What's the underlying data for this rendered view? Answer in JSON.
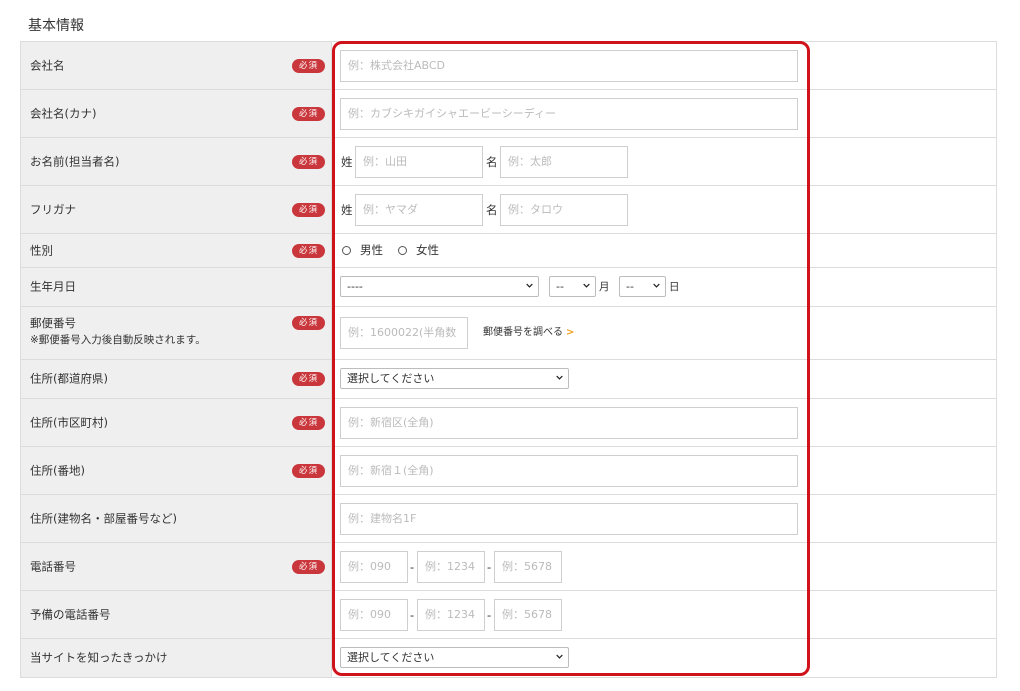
{
  "section_title": "基本情報",
  "required_label": "必須",
  "fields": {
    "company_name": {
      "label": "会社名",
      "placeholder": "例：株式会社ABCD"
    },
    "company_kana": {
      "label": "会社名(カナ)",
      "placeholder": "例：カブシキガイシャエービーシーディー"
    },
    "person_name": {
      "label": "お名前(担当者名)",
      "last_label": "姓",
      "last_placeholder": "例：山田",
      "first_label": "名",
      "first_placeholder": "例：太郎"
    },
    "furigana": {
      "label": "フリガナ",
      "last_label": "姓",
      "last_placeholder": "例：ヤマダ",
      "first_label": "名",
      "first_placeholder": "例：タロウ"
    },
    "gender": {
      "label": "性別",
      "options": [
        "男性",
        "女性"
      ]
    },
    "birthday": {
      "label": "生年月日",
      "year_value": "----",
      "month_value": "--",
      "month_unit": "月",
      "day_value": "--",
      "day_unit": "日"
    },
    "postal": {
      "label": "郵便番号",
      "note": "※郵便番号入力後自動反映されます。",
      "placeholder": "例：1600022(半角数",
      "lookup_link": "郵便番号を調べる",
      "lookup_arrow": ">"
    },
    "prefecture": {
      "label": "住所(都道府県)",
      "value": "選択してください"
    },
    "city": {
      "label": "住所(市区町村)",
      "placeholder": "例：新宿区(全角)"
    },
    "street": {
      "label": "住所(番地)",
      "placeholder": "例：新宿１(全角)"
    },
    "building": {
      "label": "住所(建物名・部屋番号など)",
      "placeholder": "例：建物名1F"
    },
    "phone": {
      "label": "電話番号",
      "p1": "例：090",
      "p2": "例：1234",
      "p3": "例：5678",
      "sep": "-"
    },
    "phone_alt": {
      "label": "予備の電話番号",
      "p1": "例：090",
      "p2": "例：1234",
      "p3": "例：5678",
      "sep": "-"
    },
    "referral": {
      "label": "当サイトを知ったきっかけ",
      "value": "選択してください"
    }
  },
  "colors": {
    "required_badge": "#c9363b",
    "highlight_border": "#d0121b",
    "label_bg": "#efefef",
    "link_arrow": "#f0a020"
  },
  "icons": {
    "select_caret": "chevron-down-icon",
    "radio": "radio-circle-icon"
  }
}
